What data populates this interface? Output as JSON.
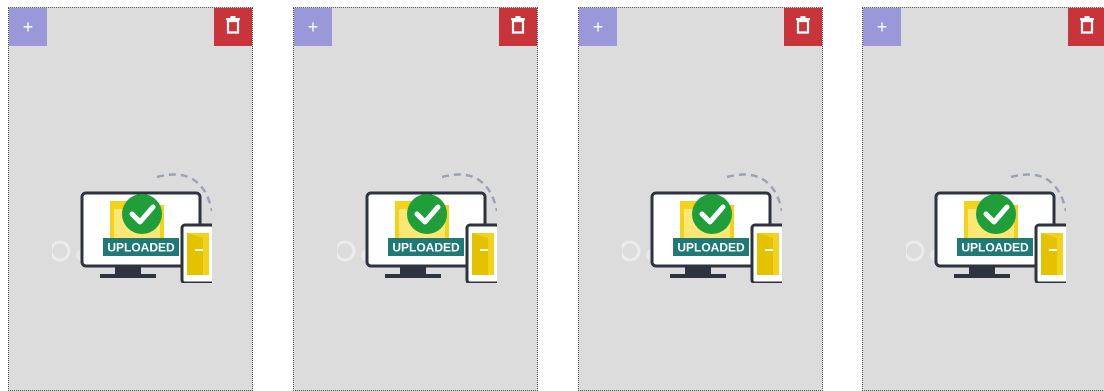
{
  "cards": [
    {
      "add_label": "+",
      "delete_icon": "trash-icon",
      "status": "UPLOADED"
    },
    {
      "add_label": "+",
      "delete_icon": "trash-icon",
      "status": "UPLOADED"
    },
    {
      "add_label": "+",
      "delete_icon": "trash-icon",
      "status": "UPLOADED"
    },
    {
      "add_label": "+",
      "delete_icon": "trash-icon",
      "status": "UPLOADED"
    }
  ],
  "colors": {
    "card_bg": "#dcdcdc",
    "add_button": "#9b98d9",
    "delete_button": "#c8343a",
    "check": "#1f9e3a",
    "banner": "#1f7a75",
    "folder": "#f2d21b"
  }
}
